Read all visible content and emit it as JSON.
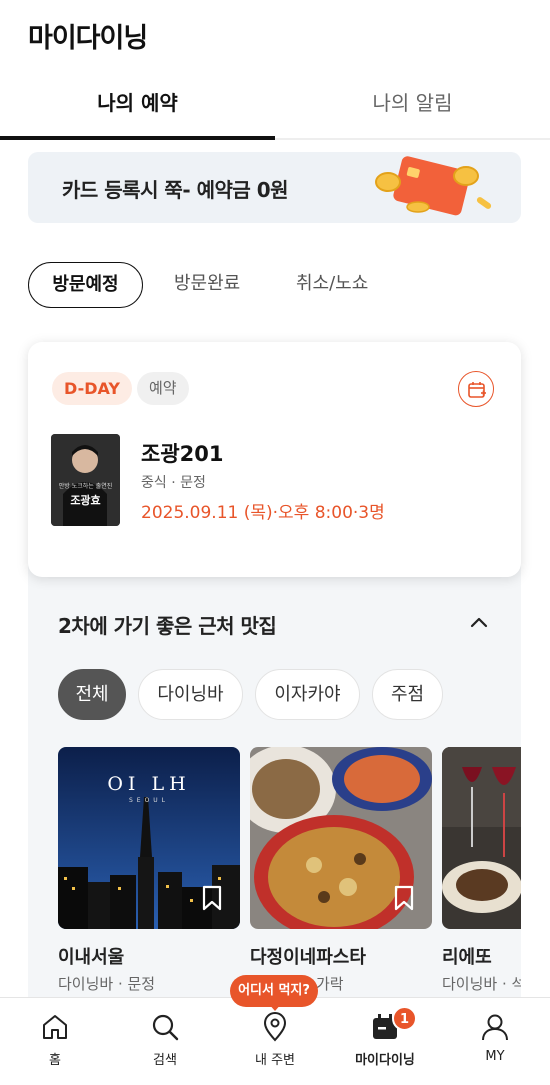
{
  "header": {
    "title": "마이다이닝"
  },
  "tabs": [
    {
      "label": "나의 예약",
      "active": true
    },
    {
      "label": "나의 알림",
      "active": false
    }
  ],
  "banner": {
    "text": "카드 등록시 쭉- 예약금 0원"
  },
  "visit_filters": [
    {
      "label": "방문예정",
      "active": true
    },
    {
      "label": "방문완료",
      "active": false
    },
    {
      "label": "취소/노쇼",
      "active": false
    }
  ],
  "reservation": {
    "dday_badge": "D-DAY",
    "status_badge": "예약",
    "thumb_caption": "안방 노크하는 출연진",
    "thumb_name": "조광효",
    "restaurant_name": "조광201",
    "meta": "중식 · 문정",
    "datetime": "2025.09.11 (목)·오후 8:00·3명",
    "accent_color": "#e8552a"
  },
  "nearby": {
    "title": "2차에 가기 좋은 근처 맛집",
    "categories": [
      {
        "label": "전체",
        "active": true
      },
      {
        "label": "다이닝바",
        "active": false
      },
      {
        "label": "이자카야",
        "active": false
      },
      {
        "label": "주점",
        "active": false
      }
    ],
    "places": [
      {
        "name": "이내서울",
        "meta": "다이닝바 · 문정",
        "image_text": "OI LH",
        "image_subtext": "SEOUL"
      },
      {
        "name": "다정이네파스타",
        "meta": "가락"
      },
      {
        "name": "리에또",
        "meta": "다이닝바 · 석"
      }
    ]
  },
  "fab": {
    "label": "어디서 먹지?"
  },
  "bottom_nav": [
    {
      "label": "홈",
      "icon": "home-icon"
    },
    {
      "label": "검색",
      "icon": "search-icon"
    },
    {
      "label": "내 주변",
      "icon": "location-pin-icon"
    },
    {
      "label": "마이다이닝",
      "icon": "calendar-icon",
      "badge": "1",
      "active": true
    },
    {
      "label": "MY",
      "icon": "person-icon"
    }
  ]
}
